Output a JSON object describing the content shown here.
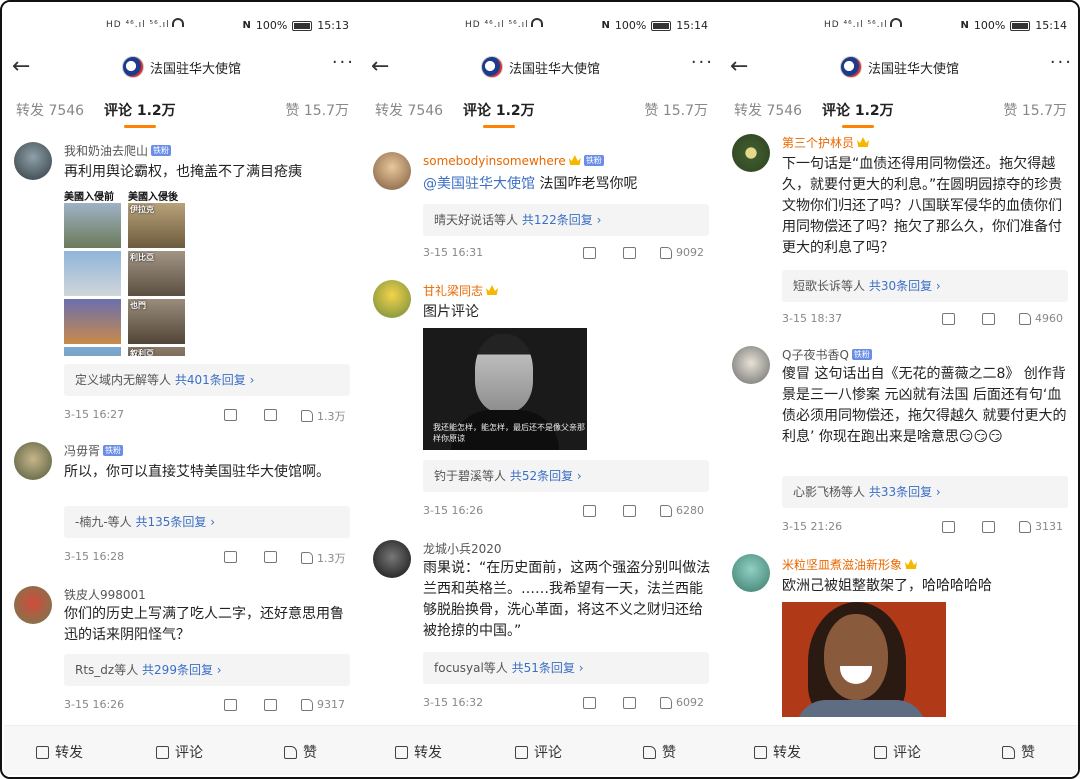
{
  "panels": [
    {
      "status": {
        "net": "HD ⁴⁶.ıl ⁵⁶.ıl",
        "battery": "100%",
        "time": "15:13"
      },
      "nav": {
        "account": "法国驻华大使馆",
        "more": "···",
        "back": "←"
      },
      "tabs": {
        "repost": "转发 7546",
        "comments": "评论 1.2万",
        "likes": "赞 15.7万"
      },
      "comments": [
        {
          "user": "我和奶油去爬山",
          "badge": "铁粉",
          "text": "再利用舆论霸权，也掩盖不了满目疮痍",
          "reply_users": "定义域内无解等人",
          "reply_count": "共401条回复 ›",
          "time": "3-15 16:27",
          "likes": "1.3万"
        },
        {
          "user": "冯毋胥",
          "badge": "铁粉",
          "text": "所以，你可以直接艾特美国驻华大使馆啊。",
          "reply_users": "-楠九-等人",
          "reply_count": "共135条回复 ›",
          "time": "3-15 16:28",
          "likes": "1.3万"
        },
        {
          "user": "铁皮人998001",
          "text": "你们的历史上写满了吃人二字，还好意思用鲁迅的话来阴阳怪气？",
          "reply_users": "Rts_dz等人",
          "reply_count": "共299条回复 ›",
          "time": "3-15 16:26",
          "likes": "9317"
        }
      ],
      "image_labels": {
        "before": "美國入侵前",
        "after": "美國入侵後",
        "tags": [
          "伊拉克",
          "利比亞",
          "也門",
          "叙利亞"
        ]
      }
    },
    {
      "status": {
        "net": "HD ⁴⁶.ıl ⁵⁶.ıl",
        "battery": "100%",
        "time": "15:14"
      },
      "nav": {
        "account": "法国驻华大使馆",
        "more": "···",
        "back": "←"
      },
      "tabs": {
        "repost": "转发 7546",
        "comments": "评论 1.2万",
        "likes": "赞 15.7万"
      },
      "comments": [
        {
          "user": "somebodyinsomewhere",
          "badge": "铁粉",
          "mention": "@美国驻华大使馆",
          "text": " 法国咋老骂你呢",
          "reply_users": "晴天好说话等人",
          "reply_count": "共122条回复 ›",
          "time": "3-15 16:31",
          "likes": "9092"
        },
        {
          "user": "甘礼梁同志",
          "text": "图片评论",
          "image_caption": "我还能怎样，能怎样，最后还不是像父亲那样你原谅",
          "reply_users": "钓于碧溪等人",
          "reply_count": "共52条回复 ›",
          "time": "3-15 16:26",
          "likes": "6280"
        },
        {
          "user": "龙城小兵2020",
          "text": "雨果说：“在历史面前，这两个强盗分别叫做法兰西和英格兰。……我希望有一天，法兰西能够脱胎换骨，洗心革面，将这不义之财归还给被抢掠的中国。”",
          "reply_users": "focusyal等人",
          "reply_count": "共51条回复 ›",
          "time": "3-15 16:32",
          "likes": "6092"
        }
      ]
    },
    {
      "status": {
        "net": "HD ⁴⁶.ıl ⁵⁶.ıl",
        "battery": "100%",
        "time": "15:14"
      },
      "nav": {
        "account": "法国驻华大使馆",
        "more": "···",
        "back": "←"
      },
      "tabs": {
        "repost": "转发 7546",
        "comments": "评论 1.2万",
        "likes": "赞 15.7万"
      },
      "comments": [
        {
          "user": "第三个护林员",
          "text": "下一句话是“血债还得用同物偿还。拖欠得越久，就要付更大的利息。”在圆明园掠夺的珍贵文物你们归还了吗？八国联军侵华的血债你们用同物偿还了吗？拖欠了那么久，你们准备付更大的利息了吗？",
          "reply_users": "短歌长诉等人",
          "reply_count": "共30条回复 ›",
          "time": "3-15 18:37",
          "likes": "4960"
        },
        {
          "user": "Q子夜书香Q",
          "badge": "铁粉",
          "text": "傻冒 这句话出自《无花的蔷薇之二8》 创作背景是三一八惨案 元凶就有法国 后面还有句‘血债必须用同物偿还，拖欠得越久 就要付更大的利息’ 你现在跑出来是啥意思😏😏😏",
          "reply_users": "心影飞杨等人",
          "reply_count": "共33条回复 ›",
          "time": "3-15 21:26",
          "likes": "3131"
        },
        {
          "user": "米粒坚皿煮滋油新形象",
          "text": "欧洲己被姐整散架了，哈哈哈哈哈"
        }
      ]
    }
  ],
  "footer": {
    "repost": "转发",
    "comment": "评论",
    "like": "赞"
  }
}
